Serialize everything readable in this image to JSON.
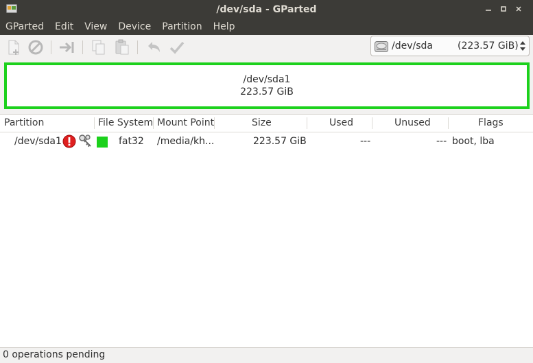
{
  "window": {
    "title": "/dev/sda - GParted"
  },
  "menu": {
    "items": [
      {
        "label": "GParted"
      },
      {
        "label": "Edit"
      },
      {
        "label": "View"
      },
      {
        "label": "Device"
      },
      {
        "label": "Partition"
      },
      {
        "label": "Help"
      }
    ]
  },
  "toolbar": {
    "icons": [
      "new-partition-icon",
      "delete-icon",
      "resize-move-icon",
      "copy-icon",
      "paste-icon",
      "undo-icon",
      "apply-icon"
    ]
  },
  "device_selector": {
    "device": "/dev/sda",
    "size": "(223.57 GiB)"
  },
  "visualizer": {
    "partition": "/dev/sda1",
    "size": "223.57 GiB",
    "color": "#1cd11c"
  },
  "table": {
    "columns": [
      "Partition",
      "File System",
      "Mount Point",
      "Size",
      "Used",
      "Unused",
      "Flags"
    ],
    "rows": [
      {
        "partition": "/dev/sda1",
        "filesystem": "fat32",
        "mount_point": "/media/kh...",
        "size": "223.57 GiB",
        "used": "---",
        "unused": "---",
        "flags": "boot, lba",
        "fs_color": "#1cd11c"
      }
    ]
  },
  "status": {
    "text": "0 operations pending"
  }
}
